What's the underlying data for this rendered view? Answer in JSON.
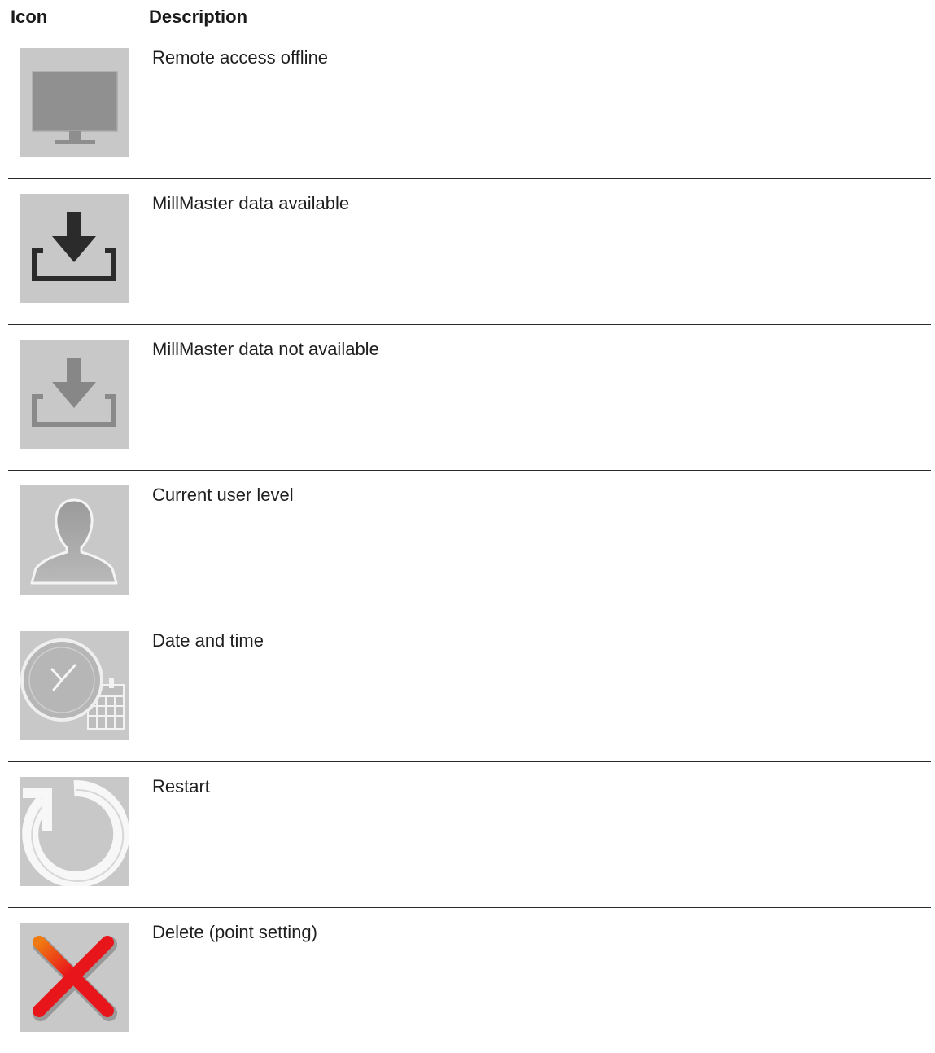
{
  "table": {
    "headers": {
      "icon": "Icon",
      "description": "Description"
    },
    "rows": [
      {
        "icon": "monitor-icon",
        "description": "Remote access offline"
      },
      {
        "icon": "download-tray-dark-icon",
        "description": "MillMaster data available"
      },
      {
        "icon": "download-tray-gray-icon",
        "description": "MillMaster data not available"
      },
      {
        "icon": "user-silhouette-icon",
        "description": "Current user level"
      },
      {
        "icon": "clock-calendar-icon",
        "description": "Date and time"
      },
      {
        "icon": "restart-arrow-icon",
        "description": "Restart"
      },
      {
        "icon": "red-x-delete-icon",
        "description": "Delete (point setting)"
      }
    ]
  },
  "colors": {
    "icon_background": "#c8c8c8",
    "rule": "#2b2b2b",
    "delete_red": "#e8151b",
    "delete_orange": "#f07a12"
  }
}
